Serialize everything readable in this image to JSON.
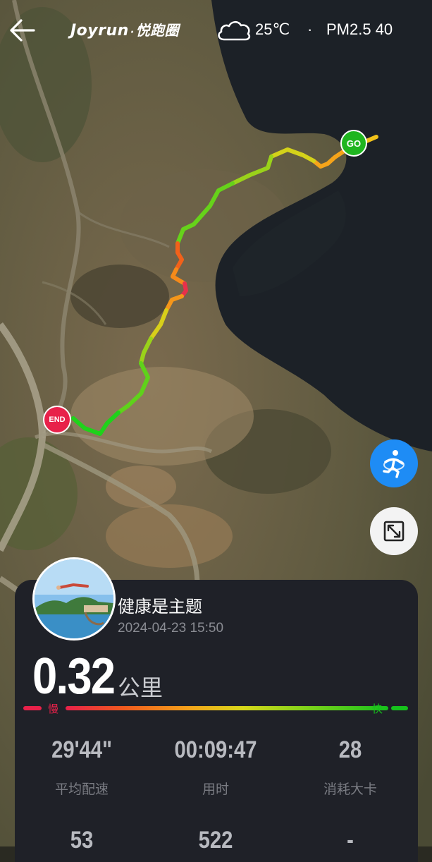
{
  "header": {
    "brand": "Joyrun",
    "brand_dot": "·",
    "brand_cn": "悦跑圈",
    "weather_icon": "cloud-icon",
    "temperature": "25℃",
    "separator": "·",
    "air_quality": "PM2.5 40"
  },
  "map": {
    "start_label": "GO",
    "end_label": "END"
  },
  "colors": {
    "slow": "#e8214a",
    "fast": "#16c21c",
    "fab_blue": "#1e8cf5",
    "card_bg": "#1f2128"
  },
  "user": {
    "name": "健康是主题",
    "datetime": "2024-04-23 15:50"
  },
  "run": {
    "distance": "0.32",
    "unit": "公里",
    "speed_slow_label": "慢",
    "speed_fast_label": "快"
  },
  "stats": [
    {
      "value": "29'44\"",
      "label": "平均配速"
    },
    {
      "value": "00:09:47",
      "label": "用时"
    },
    {
      "value": "28",
      "label": "消耗大卡"
    },
    {
      "value": "53",
      "label": ""
    },
    {
      "value": "522",
      "label": ""
    },
    {
      "value": "-",
      "label": ""
    }
  ]
}
